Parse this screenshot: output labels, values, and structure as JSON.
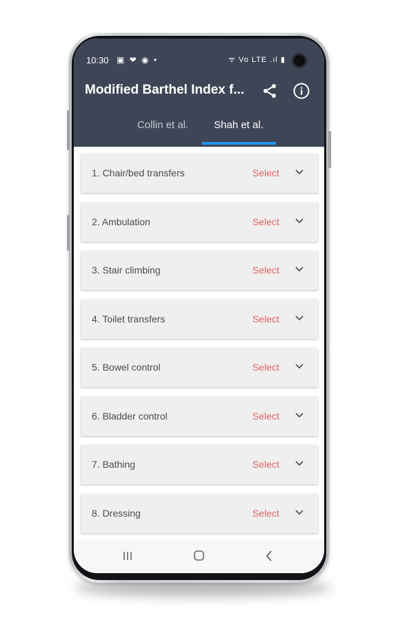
{
  "status_bar": {
    "time": "10:30",
    "left_icons": "▣ ❤ ◉ •",
    "right_icons": "ᯤ Vo LTE .ıl ▮"
  },
  "app_bar": {
    "title": "Modified Barthel Index f...",
    "share_icon": "share-icon",
    "info_icon": "info-icon",
    "color": "#3e4556"
  },
  "tabs": [
    {
      "label": "Collin et al.",
      "active": false
    },
    {
      "label": "Shah et al.",
      "active": true
    }
  ],
  "accent_color": "#2196f3",
  "select_color": "#e06363",
  "items": [
    {
      "label": "1. Chair/bed transfers",
      "action": "Select"
    },
    {
      "label": "2. Ambulation",
      "action": "Select"
    },
    {
      "label": "3. Stair climbing",
      "action": "Select"
    },
    {
      "label": "4. Toilet transfers",
      "action": "Select"
    },
    {
      "label": "5. Bowel control",
      "action": "Select"
    },
    {
      "label": "6. Bladder control",
      "action": "Select"
    },
    {
      "label": "7. Bathing",
      "action": "Select"
    },
    {
      "label": "8. Dressing",
      "action": "Select"
    }
  ],
  "nav_bar": {
    "recent_icon": "recent-apps-icon",
    "home_icon": "home-icon",
    "back_icon": "back-icon"
  }
}
